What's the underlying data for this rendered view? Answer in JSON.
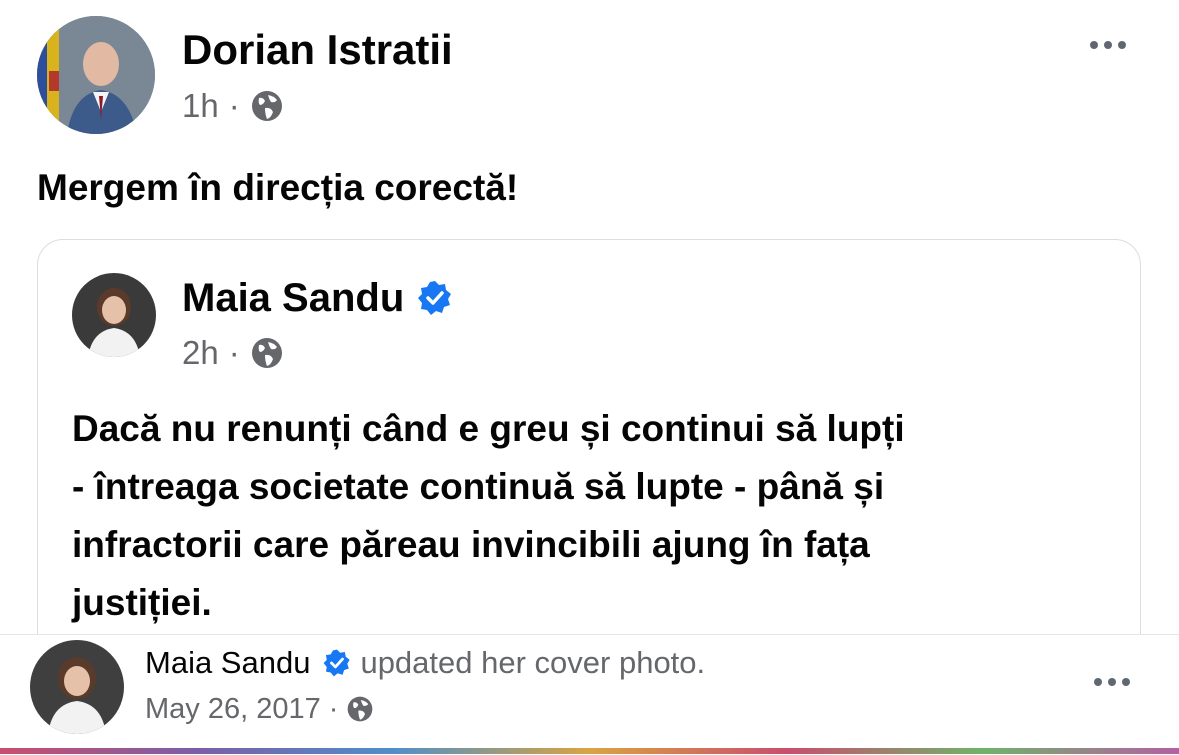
{
  "main_post": {
    "author": "Dorian Istratii",
    "time": "1h",
    "separator": "·",
    "privacy_icon": "globe-icon",
    "text": "Mergem în direcția corectă!"
  },
  "shared_post": {
    "author": "Maia Sandu",
    "verified_icon": "verified-badge-icon",
    "time": "2h",
    "separator": "·",
    "privacy_icon": "globe-icon",
    "text_lines": [
      "Dacă nu renunți când e greu și continui să lupți",
      "- întreaga societate continuă să lupte - până și",
      "infractorii care păreau invincibili ajung în fața",
      "justiției."
    ]
  },
  "next_post": {
    "author": "Maia Sandu",
    "verified_icon": "verified-badge-icon",
    "action": "updated her cover photo.",
    "date": "May 26, 2017",
    "separator": "·",
    "privacy_icon": "globe-icon"
  },
  "colors": {
    "text_primary": "#050505",
    "text_secondary": "#65676b",
    "verified_blue": "#1877f2",
    "border": "#dadde1"
  }
}
